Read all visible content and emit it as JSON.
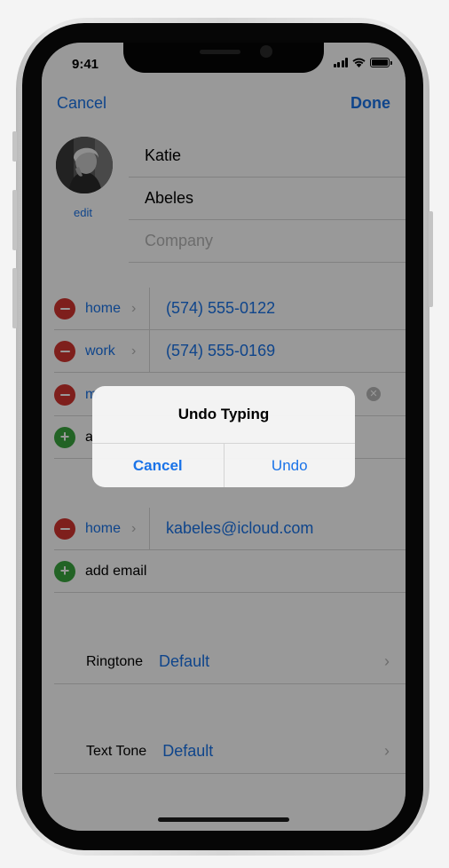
{
  "status_bar": {
    "time": "9:41"
  },
  "nav": {
    "cancel_label": "Cancel",
    "done_label": "Done"
  },
  "contact": {
    "avatar_edit_label": "edit",
    "first_name": "Katie",
    "last_name": "Abeles",
    "company_placeholder": "Company"
  },
  "phones": [
    {
      "label": "home",
      "value": "(574) 555-0122"
    },
    {
      "label": "work",
      "value": "(574) 555-0169"
    },
    {
      "label": "m"
    }
  ],
  "add_phone_label": "a",
  "emails": [
    {
      "label": "home",
      "value": "kabeles@icloud.com"
    }
  ],
  "add_email_label": "add email",
  "settings": [
    {
      "label": "Ringtone",
      "value": "Default"
    },
    {
      "label": "Text Tone",
      "value": "Default"
    }
  ],
  "alert": {
    "title": "Undo Typing",
    "cancel_label": "Cancel",
    "undo_label": "Undo"
  },
  "colors": {
    "accent": "#1a73e8",
    "delete": "#d2352f",
    "add": "#3aa63e"
  }
}
